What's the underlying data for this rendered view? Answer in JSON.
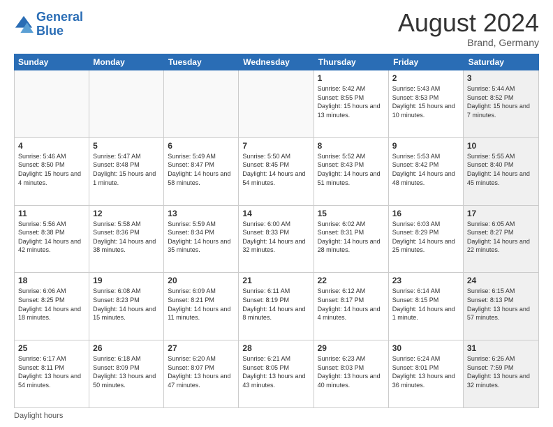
{
  "logo": {
    "line1": "General",
    "line2": "Blue"
  },
  "title": "August 2024",
  "location": "Brand, Germany",
  "days_of_week": [
    "Sunday",
    "Monday",
    "Tuesday",
    "Wednesday",
    "Thursday",
    "Friday",
    "Saturday"
  ],
  "weeks": [
    [
      {
        "day": "",
        "empty": true
      },
      {
        "day": "",
        "empty": true
      },
      {
        "day": "",
        "empty": true
      },
      {
        "day": "",
        "empty": true
      },
      {
        "day": "1",
        "sunrise": "5:42 AM",
        "sunset": "8:55 PM",
        "daylight": "15 hours and 13 minutes."
      },
      {
        "day": "2",
        "sunrise": "5:43 AM",
        "sunset": "8:53 PM",
        "daylight": "15 hours and 10 minutes."
      },
      {
        "day": "3",
        "sunrise": "5:44 AM",
        "sunset": "8:52 PM",
        "daylight": "15 hours and 7 minutes."
      }
    ],
    [
      {
        "day": "4",
        "sunrise": "5:46 AM",
        "sunset": "8:50 PM",
        "daylight": "15 hours and 4 minutes."
      },
      {
        "day": "5",
        "sunrise": "5:47 AM",
        "sunset": "8:48 PM",
        "daylight": "15 hours and 1 minute."
      },
      {
        "day": "6",
        "sunrise": "5:49 AM",
        "sunset": "8:47 PM",
        "daylight": "14 hours and 58 minutes."
      },
      {
        "day": "7",
        "sunrise": "5:50 AM",
        "sunset": "8:45 PM",
        "daylight": "14 hours and 54 minutes."
      },
      {
        "day": "8",
        "sunrise": "5:52 AM",
        "sunset": "8:43 PM",
        "daylight": "14 hours and 51 minutes."
      },
      {
        "day": "9",
        "sunrise": "5:53 AM",
        "sunset": "8:42 PM",
        "daylight": "14 hours and 48 minutes."
      },
      {
        "day": "10",
        "sunrise": "5:55 AM",
        "sunset": "8:40 PM",
        "daylight": "14 hours and 45 minutes."
      }
    ],
    [
      {
        "day": "11",
        "sunrise": "5:56 AM",
        "sunset": "8:38 PM",
        "daylight": "14 hours and 42 minutes."
      },
      {
        "day": "12",
        "sunrise": "5:58 AM",
        "sunset": "8:36 PM",
        "daylight": "14 hours and 38 minutes."
      },
      {
        "day": "13",
        "sunrise": "5:59 AM",
        "sunset": "8:34 PM",
        "daylight": "14 hours and 35 minutes."
      },
      {
        "day": "14",
        "sunrise": "6:00 AM",
        "sunset": "8:33 PM",
        "daylight": "14 hours and 32 minutes."
      },
      {
        "day": "15",
        "sunrise": "6:02 AM",
        "sunset": "8:31 PM",
        "daylight": "14 hours and 28 minutes."
      },
      {
        "day": "16",
        "sunrise": "6:03 AM",
        "sunset": "8:29 PM",
        "daylight": "14 hours and 25 minutes."
      },
      {
        "day": "17",
        "sunrise": "6:05 AM",
        "sunset": "8:27 PM",
        "daylight": "14 hours and 22 minutes."
      }
    ],
    [
      {
        "day": "18",
        "sunrise": "6:06 AM",
        "sunset": "8:25 PM",
        "daylight": "14 hours and 18 minutes."
      },
      {
        "day": "19",
        "sunrise": "6:08 AM",
        "sunset": "8:23 PM",
        "daylight": "14 hours and 15 minutes."
      },
      {
        "day": "20",
        "sunrise": "6:09 AM",
        "sunset": "8:21 PM",
        "daylight": "14 hours and 11 minutes."
      },
      {
        "day": "21",
        "sunrise": "6:11 AM",
        "sunset": "8:19 PM",
        "daylight": "14 hours and 8 minutes."
      },
      {
        "day": "22",
        "sunrise": "6:12 AM",
        "sunset": "8:17 PM",
        "daylight": "14 hours and 4 minutes."
      },
      {
        "day": "23",
        "sunrise": "6:14 AM",
        "sunset": "8:15 PM",
        "daylight": "14 hours and 1 minute."
      },
      {
        "day": "24",
        "sunrise": "6:15 AM",
        "sunset": "8:13 PM",
        "daylight": "13 hours and 57 minutes."
      }
    ],
    [
      {
        "day": "25",
        "sunrise": "6:17 AM",
        "sunset": "8:11 PM",
        "daylight": "13 hours and 54 minutes."
      },
      {
        "day": "26",
        "sunrise": "6:18 AM",
        "sunset": "8:09 PM",
        "daylight": "13 hours and 50 minutes."
      },
      {
        "day": "27",
        "sunrise": "6:20 AM",
        "sunset": "8:07 PM",
        "daylight": "13 hours and 47 minutes."
      },
      {
        "day": "28",
        "sunrise": "6:21 AM",
        "sunset": "8:05 PM",
        "daylight": "13 hours and 43 minutes."
      },
      {
        "day": "29",
        "sunrise": "6:23 AM",
        "sunset": "8:03 PM",
        "daylight": "13 hours and 40 minutes."
      },
      {
        "day": "30",
        "sunrise": "6:24 AM",
        "sunset": "8:01 PM",
        "daylight": "13 hours and 36 minutes."
      },
      {
        "day": "31",
        "sunrise": "6:26 AM",
        "sunset": "7:59 PM",
        "daylight": "13 hours and 32 minutes."
      }
    ]
  ],
  "footer": "Daylight hours"
}
